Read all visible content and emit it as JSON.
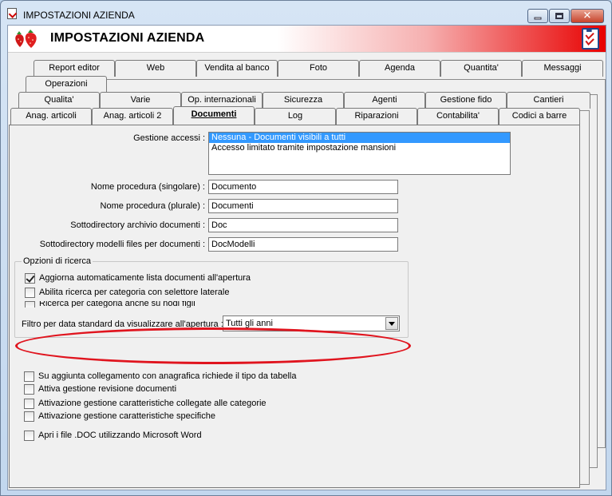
{
  "window": {
    "title": "IMPOSTAZIONI AZIENDA",
    "minimize_label": "",
    "maximize_label": "",
    "close_label": "✕"
  },
  "banner": {
    "title": "IMPOSTAZIONI AZIENDA"
  },
  "tabs": {
    "row1": [
      "Report editor",
      "Web",
      "Vendita al banco",
      "Foto",
      "Agenda",
      "Quantita'",
      "Messaggi"
    ],
    "row1b": [
      "Operazioni"
    ],
    "row2": [
      "Qualita'",
      "Varie",
      "Op. internazionali",
      "Sicurezza",
      "Agenti",
      "Gestione fido",
      "Cantieri"
    ],
    "row3": [
      "Anag. articoli",
      "Anag. articoli 2",
      "Documenti",
      "Log",
      "Riparazioni",
      "Contabilita'",
      "Codici a barre"
    ],
    "active": "Documenti"
  },
  "form": {
    "access_label": "Gestione accessi :",
    "access_options": [
      "Nessuna - Documenti visibili a tutti",
      "Accesso limitato tramite impostazione mansioni"
    ],
    "access_selected": 0,
    "name_singular_label": "Nome procedura (singolare) :",
    "name_singular_value": "Documento",
    "name_plural_label": "Nome procedura (plurale) :",
    "name_plural_value": "Documenti",
    "subdir_label": "Sottodirectory archivio documenti :",
    "subdir_value": "Doc",
    "subdir_models_label": "Sottodirectory modelli files per documenti :",
    "subdir_models_value": "DocModelli"
  },
  "search_options": {
    "title": "Opzioni di ricerca",
    "auto_refresh": "Aggiorna automaticamente lista documenti all'apertura",
    "category_search": "Abilita ricerca per categoria con selettore laterale",
    "category_children": "Ricerca per categoria anche su nodi figli",
    "filter_label": "Filtro per data standard da visualizzare all'apertura :",
    "filter_value": "Tutti gli anni"
  },
  "checks": {
    "link_anag": "Su aggiunta collegamento con anagrafica richiede il tipo da tabella",
    "revision": "Attiva gestione revisione documenti",
    "features_categories": "Attivazione gestione caratteristiche collegate alle categorie",
    "features_specific": "Attivazione gestione caratteristiche specifiche",
    "open_word": "Apri i file .DOC utilizzando Microsoft Word"
  },
  "colors": {
    "selection": "#3399ff",
    "highlight_oval": "#e0141e",
    "banner_red": "#e80000"
  }
}
